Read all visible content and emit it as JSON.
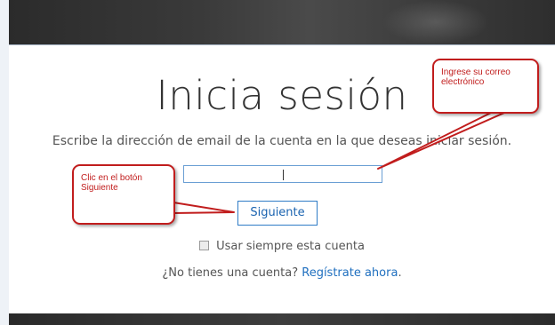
{
  "page": {
    "title": "Inicia sesión",
    "subtitle": "Escribe la dirección de email de la cuenta en la que deseas iniciar sesión."
  },
  "form": {
    "email_value": "",
    "next_button_label": "Siguiente",
    "remember_label": "Usar siempre esta cuenta",
    "remember_checked": false,
    "no_account_text": "¿No tienes una cuenta? ",
    "register_link": "Regístrate ahora",
    "register_suffix": "."
  },
  "annotations": {
    "email_callout": "Ingrese su correo electrónico",
    "next_callout": "Clic en el botón Siguiente",
    "color": "#c11d1d"
  },
  "colors": {
    "link": "#1f6fbf",
    "input_border": "#6a9fd4",
    "button_border": "#2f7cc6"
  }
}
